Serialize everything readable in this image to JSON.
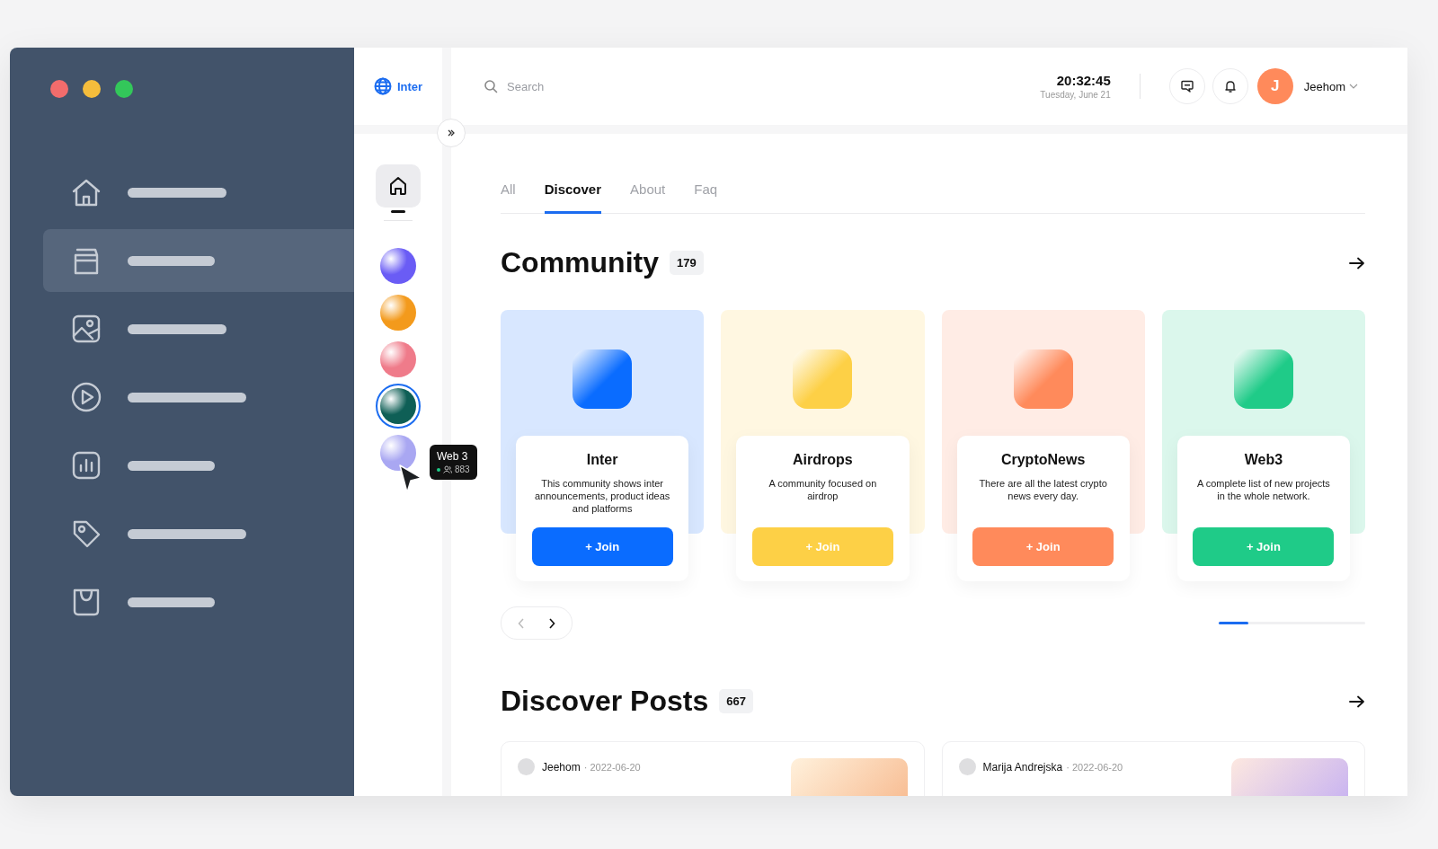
{
  "window_controls": [
    {
      "color": "#f26c6c"
    },
    {
      "color": "#f5bd3c"
    },
    {
      "color": "#33c75a"
    }
  ],
  "sidebar": {
    "items": [
      {
        "selected": false
      },
      {
        "selected": true
      },
      {
        "selected": false
      },
      {
        "selected": false
      },
      {
        "selected": false
      },
      {
        "selected": false
      },
      {
        "selected": false
      }
    ]
  },
  "brand": {
    "name": "Inter"
  },
  "rail": {
    "home_selected": true,
    "communities": [
      {
        "color": "#6a5cf5",
        "selected": false
      },
      {
        "color": "#f39a1c",
        "selected": false
      },
      {
        "color": "#ef7b8a",
        "selected": false
      },
      {
        "color": "#0f5f56",
        "selected": true
      },
      {
        "color": "#a9a7f2",
        "selected": false
      }
    ],
    "tooltip": {
      "title": "Web 3",
      "members": "883"
    }
  },
  "header": {
    "search": {
      "placeholder": "Search"
    },
    "time": "20:32:45",
    "date": "Tuesday, June 21",
    "user": {
      "initial": "J",
      "name": "Jeehom"
    }
  },
  "tabs": [
    {
      "label": "All",
      "selected": false
    },
    {
      "label": "Discover",
      "selected": true
    },
    {
      "label": "About",
      "selected": false
    },
    {
      "label": "Faq",
      "selected": false
    }
  ],
  "community": {
    "title": "Community",
    "count": "179",
    "cards": [
      {
        "name": "Inter",
        "description": "This community shows inter announcements, product ideas and platforms",
        "button": "+ Join",
        "color": "#0a6cff"
      },
      {
        "name": "Airdrops",
        "description": "A community focused on airdrop",
        "button": "+ Join",
        "color": "#fdd046"
      },
      {
        "name": "CryptoNews",
        "description": "There are all the latest crypto news every day.",
        "button": "+ Join",
        "color": "#ff8a5b"
      },
      {
        "name": "Web3",
        "description": "A complete list of new projects in the whole network.",
        "button": "+ Join",
        "color": "#1fcb88"
      }
    ]
  },
  "posts": {
    "title": "Discover Posts",
    "count": "667",
    "items": [
      {
        "author": "Jeehom",
        "date": "· 2022-06-20"
      },
      {
        "author": "Marija Andrejska",
        "date": "· 2022-06-20"
      }
    ]
  }
}
